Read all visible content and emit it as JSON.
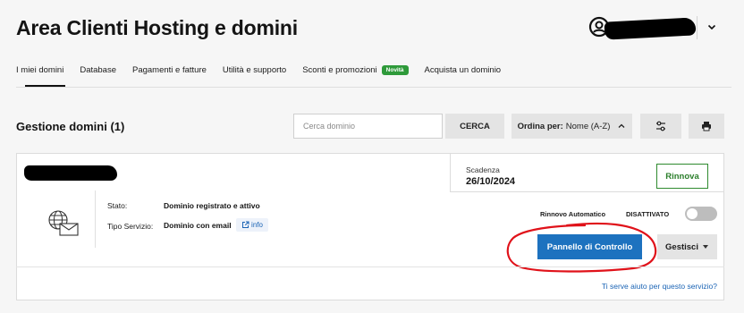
{
  "header": {
    "title": "Area Clienti Hosting e domini"
  },
  "tabs": [
    {
      "label": "I miei domini"
    },
    {
      "label": "Database"
    },
    {
      "label": "Pagamenti e fatture"
    },
    {
      "label": "Utilità e supporto"
    },
    {
      "label": "Sconti e promozioni",
      "badge": "Novità"
    },
    {
      "label": "Acquista un dominio"
    }
  ],
  "domains": {
    "heading": "Gestione domini (1)",
    "search_placeholder": "Cerca dominio",
    "search_button": "CERCA",
    "sort_prefix": "Ordina per:",
    "sort_value": "Nome (A-Z)"
  },
  "card": {
    "expiry_label": "Scadenza",
    "expiry_date": "26/10/2024",
    "renew_button": "Rinnova",
    "status_label": "Stato:",
    "status_value": "Dominio registrato e attivo",
    "service_label": "Tipo Servizio:",
    "service_value": "Dominio con email",
    "info_label": "info",
    "auto_renew_label": "Rinnovo Automatico",
    "auto_renew_value": "DISATTIVATO",
    "control_panel_button": "Pannello di Controllo",
    "manage_button": "Gestisci",
    "help_link": "Ti serve aiuto per questo servizio?"
  },
  "colors": {
    "primary": "#1d72bf",
    "green": "#2e9a3a",
    "annotation": "#e0121a"
  }
}
